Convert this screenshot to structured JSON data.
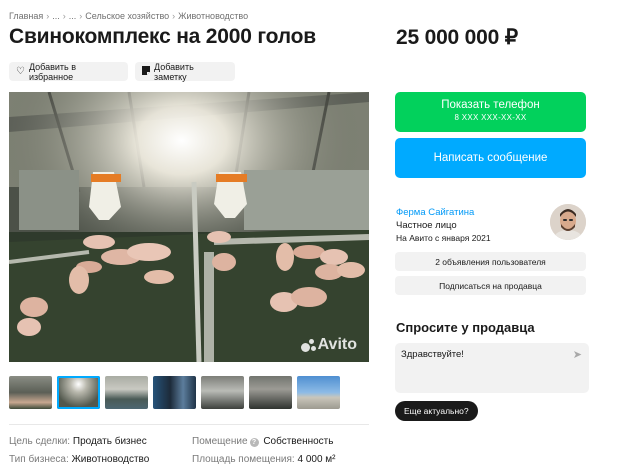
{
  "breadcrumbs": [
    "Главная",
    "...",
    "...",
    "Сельское хозяйство",
    "Животноводство"
  ],
  "breadcrumb_separator": "›",
  "title": "Свинокомплекс на 2000 голов",
  "price": "25 000 000 ₽",
  "actions": {
    "favorite_label": "Добавить в избранное",
    "note_label": "Добавить заметку"
  },
  "gallery": {
    "watermark": "Avito",
    "thumbnail_count": 7,
    "active_thumbnail_index": 1
  },
  "contact": {
    "phone_label": "Показать телефон",
    "phone_masked": "8 XXX XXX-XX-XX",
    "message_label": "Написать сообщение"
  },
  "seller": {
    "name": "Ферма Сайгатина",
    "type": "Частное лицо",
    "since": "На Авито с января 2021",
    "ads_label": "2 объявления пользователя",
    "subscribe_label": "Подписаться на продавца"
  },
  "ask": {
    "title": "Спросите у продавца",
    "message_value": "Здравствуйте!",
    "quick_reply": "Еще актуально?"
  },
  "params": [
    {
      "label": "Цель сделки:",
      "value": "Продать бизнес"
    },
    {
      "label": "Помещение",
      "value": "Собственность"
    },
    {
      "label": "Тип бизнеса:",
      "value": "Животноводство"
    },
    {
      "label": "Площадь помещения:",
      "value": "4 000 м²"
    }
  ],
  "colors": {
    "green": "#02d15c",
    "blue": "#00aaff",
    "link": "#0099f7",
    "gray_button": "#f2f2f2"
  },
  "icons": {
    "favorite": "heart-icon",
    "note": "note-icon",
    "info": "info-icon",
    "send": "send-icon"
  }
}
